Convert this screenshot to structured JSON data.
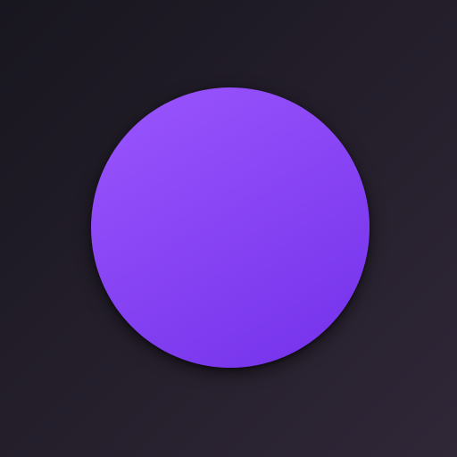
{
  "colors": {
    "background_start": "#18161f",
    "background_end": "#302737",
    "disc_start": "#9b56fd",
    "disc_end": "#7331ea"
  },
  "shapes": {
    "disc": "circle"
  }
}
